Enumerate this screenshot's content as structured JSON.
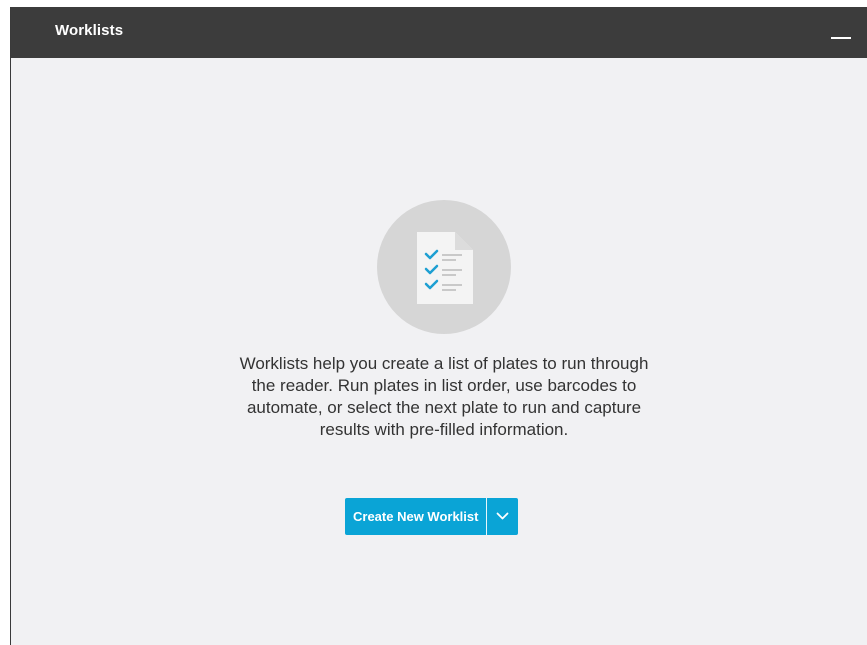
{
  "window": {
    "title": "Worklists"
  },
  "empty_state": {
    "illustration_icon": "checklist-document-icon",
    "description": "Worklists help you create a list of plates to run through\nthe reader. Run plates in list order, use barcodes to\nautomate, or select the next plate to run and capture\nresults with pre-filled information.",
    "create_button_label": "Create New Worklist",
    "dropdown_icon": "chevron-down-icon"
  },
  "colors": {
    "titlebar": "#3c3c3c",
    "background": "#f1f1f3",
    "accent": "#0aa4d6",
    "checkmark": "#1d9fd2"
  }
}
